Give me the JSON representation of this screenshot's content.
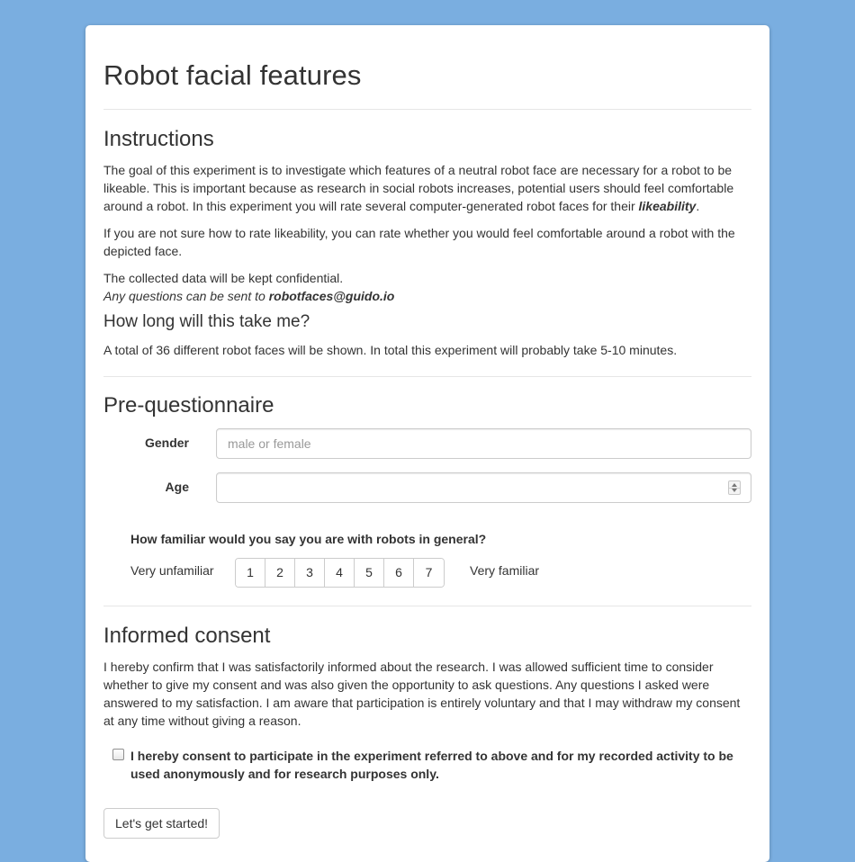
{
  "page": {
    "title": "Robot facial features",
    "background_color": "#7aaee0"
  },
  "instructions": {
    "heading": "Instructions",
    "paragraph1_part1": "The goal of this experiment is to investigate which features of a neutral robot face are necessary for a robot to be likeable. This is important because as research in social robots increases, potential users should feel comfortable around a robot. In this experiment you will rate several computer-generated robot faces for their ",
    "paragraph1_emphasis": "likeability",
    "paragraph1_end": ".",
    "paragraph2": "If you are not sure how to rate likeability, you can rate whether you would feel comfortable around a robot with the depicted face.",
    "paragraph3": "The collected data will be kept confidential.",
    "questions_prefix": "Any questions can be sent to ",
    "contact_email": "robotfaces@guido.io"
  },
  "duration": {
    "heading": "How long will this take me?",
    "text": "A total of 36 different robot faces will be shown. In total this experiment will probably take 5-10 minutes."
  },
  "prequestionnaire": {
    "heading": "Pre-questionnaire",
    "gender_label": "Gender",
    "gender_placeholder": "male or female",
    "gender_value": "",
    "age_label": "Age",
    "age_value": "",
    "familiarity_question": "How familiar would you say you are with robots in general?",
    "scale_low_label": "Very unfamiliar",
    "scale_high_label": "Very familiar",
    "scale_options": [
      "1",
      "2",
      "3",
      "4",
      "5",
      "6",
      "7"
    ]
  },
  "consent": {
    "heading": "Informed consent",
    "text": "I hereby confirm that I was satisfactorily informed about the research. I was allowed sufficient time to consider whether to give my consent and was also given the opportunity to ask questions. Any questions I asked were answered to my satisfaction. I am aware that participation is entirely voluntary and that I may withdraw my consent at any time without giving a reason.",
    "checkbox_label": "I hereby consent to participate in the experiment referred to above and for my recorded activity to be used anonymously and for research purposes only.",
    "checked": false
  },
  "actions": {
    "start_label": "Let's get started!"
  }
}
